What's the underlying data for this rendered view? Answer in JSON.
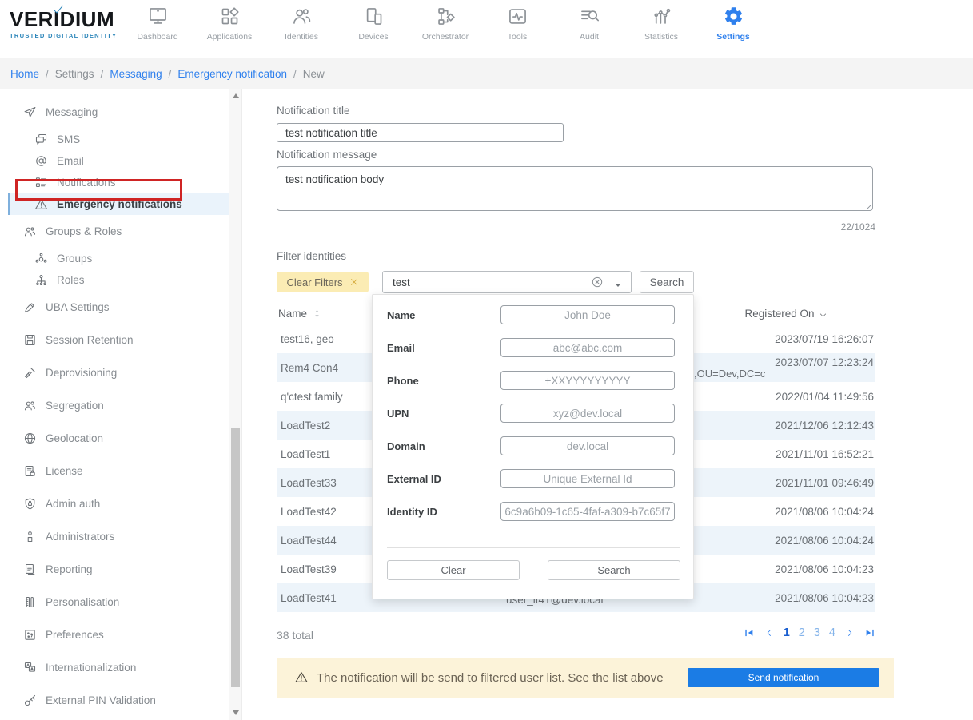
{
  "brand": {
    "name": "VERIDIUM",
    "tagline": "TRUSTED DIGITAL IDENTITY"
  },
  "nav": {
    "items": [
      {
        "label": "Dashboard",
        "icon": "dashboard"
      },
      {
        "label": "Applications",
        "icon": "applications"
      },
      {
        "label": "Identities",
        "icon": "identities"
      },
      {
        "label": "Devices",
        "icon": "devices"
      },
      {
        "label": "Orchestrator",
        "icon": "orchestrator"
      },
      {
        "label": "Tools",
        "icon": "tools"
      },
      {
        "label": "Audit",
        "icon": "audit"
      },
      {
        "label": "Statistics",
        "icon": "statistics"
      },
      {
        "label": "Settings",
        "icon": "settings",
        "active": true
      }
    ]
  },
  "breadcrumb": {
    "separator": "/",
    "items": [
      {
        "label": "Home",
        "link": true
      },
      {
        "label": "Settings"
      },
      {
        "label": "Messaging",
        "link": true
      },
      {
        "label": "Emergency notification",
        "link": true
      },
      {
        "label": "New"
      }
    ]
  },
  "sidebar": {
    "items": [
      {
        "label": "Messaging",
        "icon": "paper-plane",
        "level": "top"
      },
      {
        "label": "SMS",
        "icon": "sms",
        "level": "sub"
      },
      {
        "label": "Email",
        "icon": "at-sign",
        "level": "sub"
      },
      {
        "label": "Notifications",
        "icon": "list-squares",
        "level": "sub"
      },
      {
        "label": "Emergency notifications",
        "icon": "warning-triangle",
        "level": "sub",
        "active": true
      },
      {
        "label": "Groups & Roles",
        "icon": "users",
        "level": "top"
      },
      {
        "label": "Groups",
        "icon": "group-circle",
        "level": "sub"
      },
      {
        "label": "Roles",
        "icon": "roles-org",
        "level": "sub"
      },
      {
        "label": "UBA Settings",
        "icon": "pen",
        "level": "top"
      },
      {
        "label": "Session Retention",
        "icon": "floppy-disk",
        "level": "top"
      },
      {
        "label": "Deprovisioning",
        "icon": "broom",
        "level": "top"
      },
      {
        "label": "Segregation",
        "icon": "users",
        "level": "top"
      },
      {
        "label": "Geolocation",
        "icon": "globe",
        "level": "top"
      },
      {
        "label": "License",
        "icon": "document-lock",
        "level": "top"
      },
      {
        "label": "Admin auth",
        "icon": "shield-lock",
        "level": "top"
      },
      {
        "label": "Administrators",
        "icon": "person",
        "level": "top"
      },
      {
        "label": "Reporting",
        "icon": "document-lines",
        "level": "top"
      },
      {
        "label": "Personalisation",
        "icon": "ruler",
        "level": "top"
      },
      {
        "label": "Preferences",
        "icon": "dots-box",
        "level": "top"
      },
      {
        "label": "Internationalization",
        "icon": "translate",
        "level": "top"
      },
      {
        "label": "External PIN Validation",
        "icon": "key",
        "level": "top"
      }
    ]
  },
  "form": {
    "title_label": "Notification title",
    "title_value": "test notification title",
    "message_label": "Notification message",
    "message_value": "test notification body",
    "char_counter": "22/1024"
  },
  "filter": {
    "section_label": "Filter identities",
    "clear_chip_label": "Clear Filters",
    "search_value": "test",
    "search_button_label": "Search"
  },
  "filter_panel": {
    "fields": [
      {
        "label": "Name",
        "placeholder": "John Doe"
      },
      {
        "label": "Email",
        "placeholder": "abc@abc.com"
      },
      {
        "label": "Phone",
        "placeholder": "+XXYYYYYYYYY"
      },
      {
        "label": "UPN",
        "placeholder": "xyz@dev.local"
      },
      {
        "label": "Domain",
        "placeholder": "dev.local"
      },
      {
        "label": "External ID",
        "placeholder": "Unique External Id"
      },
      {
        "label": "Identity ID",
        "placeholder": "6c9a6b09-1c65-4faf-a309-b7c65f7"
      }
    ],
    "clear_button_label": "Clear",
    "search_button_label": "Search"
  },
  "table": {
    "name_header": "Name",
    "registered_header": "Registered On",
    "rows": [
      {
        "name": "test16, geo",
        "registered": "2023/07/19 16:26:07"
      },
      {
        "name": "Rem4 Con4",
        "registered": "2023/07/07 12:23:24",
        "dn_fragment": ",OU=Dev,DC=c"
      },
      {
        "name": "q'ctest family",
        "registered": "2022/01/04 11:49:56"
      },
      {
        "name": "LoadTest2",
        "registered": "2021/12/06 12:12:43"
      },
      {
        "name": "LoadTest1",
        "registered": "2021/11/01 16:52:21"
      },
      {
        "name": "LoadTest33",
        "registered": "2021/11/01 09:46:49"
      },
      {
        "name": "LoadTest42",
        "registered": "2021/08/06 10:04:24"
      },
      {
        "name": "LoadTest44",
        "registered": "2021/08/06 10:04:24"
      },
      {
        "name": "LoadTest39",
        "registered": "2021/08/06 10:04:23"
      },
      {
        "name": "LoadTest41",
        "registered": "2021/08/06 10:04:23",
        "upn_fragment": "user_lt41@dev.local"
      }
    ],
    "total": "38 total",
    "pagination": {
      "pages": [
        {
          "label": "1",
          "active": true
        },
        {
          "label": "2"
        },
        {
          "label": "3"
        },
        {
          "label": "4"
        }
      ]
    }
  },
  "banner": {
    "text": "The notification will be send to filtered user list. See the list above",
    "button_label": "Send notification"
  },
  "colors": {
    "accent_blue": "#2f80ed",
    "chip_yellow_bg": "#fbecb4",
    "banner_bg": "#fcf3d9",
    "row_alt_bg": "#edf4fa",
    "annotation_red": "#cf2424",
    "send_button_blue": "#1b7ce5",
    "brand_teal": "#2d86ba",
    "active_item_bg": "#eaf3fb"
  }
}
